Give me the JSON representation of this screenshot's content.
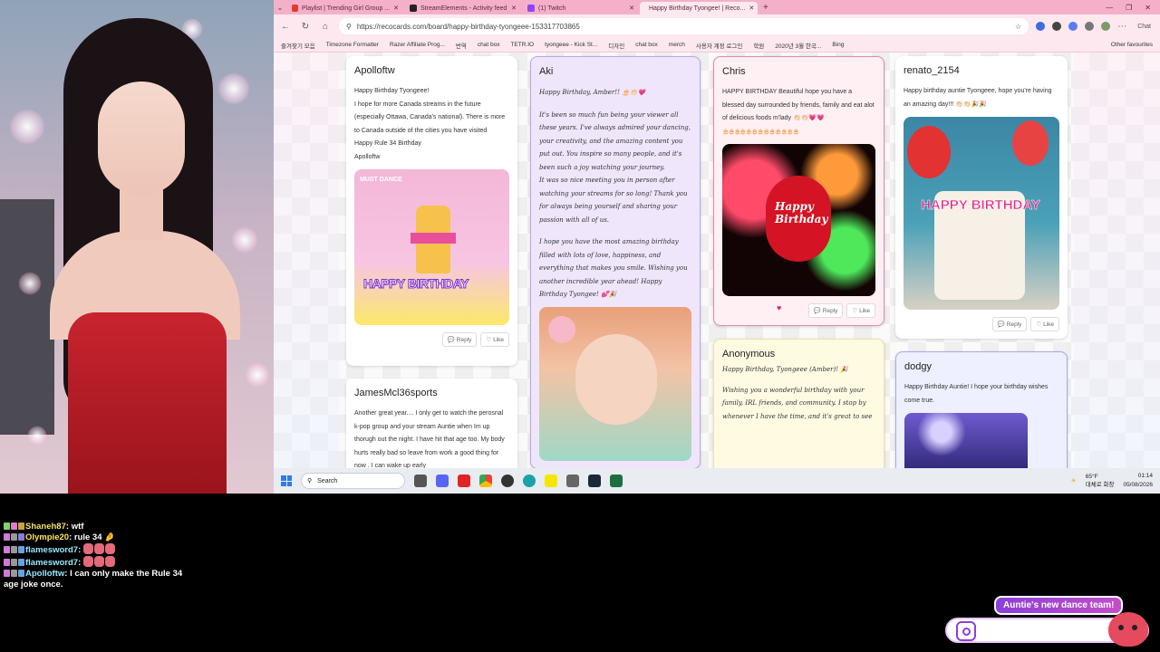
{
  "browser": {
    "tabs": [
      {
        "label": "Playlist | Trending Girl Group ...",
        "color": "#e53935",
        "active": false
      },
      {
        "label": "StreamElements - Activity feed",
        "color": "#222222",
        "active": false
      },
      {
        "label": "(1) Twitch",
        "color": "#8e44ff",
        "active": false
      },
      {
        "label": "Happy Birthday Tyongee! | Reco...",
        "color": "#e91e63",
        "active": true
      }
    ],
    "new_tab": "+",
    "url": "https://recocards.com/board/happy-birthday-tyongeee-153317703865",
    "chat_button": "Chat",
    "bookmarks": [
      "즐겨찾기 모음",
      "Timezone Formatter",
      "Razer Affiliate Prog...",
      "번역",
      "chat box",
      "TETR.IO",
      "tyongeee - Kick St...",
      "디자인",
      "chat box",
      "merch",
      "사용자 계정 로그인",
      "학원",
      "2020년 3월 한국...",
      "Bing",
      "Other favourites"
    ]
  },
  "cards": {
    "apolloftw": {
      "name": "Apolloftw",
      "lines": [
        "Happy Birthday Tyongeee!",
        "I hope for more Canada streams in the future (especially Ottawa, Canada's national). There is more to Canada outside of the cities you have visited",
        "Happy Rule 34 Birthday",
        "Apolloftw"
      ],
      "image_text_top": "MUST DANCE",
      "image_text": "HAPPY BIRTHDAY",
      "reply": "Reply",
      "like": "Like"
    },
    "aki": {
      "name": "Aki",
      "p1": "Happy Birthday, Amber!! 🎂👏🏻💗",
      "p2": "It's been so much fun being your viewer all these years. I've always admired your dancing, your creativity, and the amazing content you put out. You inspire so many people, and it's been such a joy watching your journey.",
      "p3": "It was so nice meeting you in person after watching your streams for so long! Thank you for always being yourself and sharing your passion with all of us.",
      "p4": "I hope you have the most amazing birthday filled with lots of love, happiness, and everything that makes you smile. Wishing you another incredible year ahead! Happy Birthday Tyongee! 💕🎉"
    },
    "chris": {
      "name": "Chris",
      "text": "HAPPY BIRTHDAY Beautiful hope you have a blessed day surrounded by friends, family and eat alot of delicious foods m'lady 👏🏻👏🏻💗💗",
      "cakes": "🎂🎂🎂🎂🎂🎂🎂🎂🎂🎂🎂🎂🎂",
      "image_text": "Happy Birthday",
      "reply": "Reply",
      "like": "Like"
    },
    "renato": {
      "name": "renato_2154",
      "text": "Happy birthday auntie Tyongeee, hope you're having an amazing day!!! 👏🏻👏🏻🎉🎉",
      "image_text": "HAPPY BIRTHDAY",
      "reply": "Reply",
      "like": "Like"
    },
    "james": {
      "name": "JamesMcl36sports",
      "text": "Another great year.... I only get to watch the perosnal k-pop group and your stream Auntie when Im up thorugh out the night. I have hit that age too. My body hurts really bad so leave from work a good thing for now . I can wake up early"
    },
    "anonymous": {
      "name": "Anonymous",
      "title": "Happy Birthday, Tyongeee (Amber)! 🎉",
      "text": "Wishing you a wonderful birthday with your family, IRL friends, and community. I stop by whenever I have the time, and it's great to see"
    },
    "dodgy": {
      "name": "dodgy",
      "text": "Happy Birthday Auntie! I hope your birthday wishes come true."
    }
  },
  "taskbar": {
    "search_label": "Search",
    "temperature": "65°F",
    "weather_desc": "대체로 화창",
    "time": "01:14",
    "date": "05/08/2026"
  },
  "chat": [
    {
      "user": "Shaneh87",
      "color": "#f6e26b",
      "message": "wtf",
      "emotes": 0
    },
    {
      "user": "Olympie20",
      "color": "#ffe75a",
      "message": "rule 34 🤌",
      "emotes": 0
    },
    {
      "user": "flamesword7",
      "color": "#9be8ff",
      "message": "",
      "emotes": 3
    },
    {
      "user": "flamesword7",
      "color": "#9be8ff",
      "message": "",
      "emotes": 3
    },
    {
      "user": "Apolloftw",
      "color": "#9be8ff",
      "message": "I can only make the Rule 34 age joke once.",
      "emotes": 0
    }
  ],
  "widget": {
    "bubble": "Auntie's new dance team!"
  }
}
